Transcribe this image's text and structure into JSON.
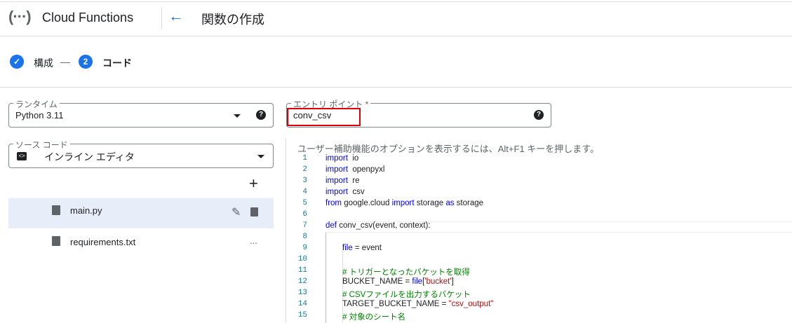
{
  "header": {
    "product": "Cloud Functions",
    "page_title": "関数の作成",
    "logo_icon": "cloud-functions-logo",
    "back_icon": "arrow-left-icon"
  },
  "stepper": {
    "steps": [
      {
        "label": "構成",
        "state": "done"
      },
      {
        "number": "2",
        "label": "コード",
        "state": "active"
      }
    ],
    "separator": "—"
  },
  "runtime": {
    "label": "ランタイム",
    "value": "Python 3.11",
    "help": "?"
  },
  "entry_point": {
    "label": "エントリ ポイント *",
    "value": "conv_csv",
    "help": "?",
    "highlight_color": "#e00000"
  },
  "source": {
    "label": "ソース コード",
    "value": "インライン エディタ"
  },
  "files": {
    "add": "+",
    "items": [
      {
        "name": "main.py",
        "selected": true
      },
      {
        "name": "requirements.txt",
        "selected": false,
        "more": "..."
      }
    ]
  },
  "editor": {
    "aria_hint": "ユーザー補助機能のオプションを表示するには、Alt+F1 キーを押します。",
    "lines": [
      {
        "n": "1",
        "tokens": [
          [
            "kw",
            "import"
          ],
          [
            "",
            "  io"
          ]
        ]
      },
      {
        "n": "2",
        "tokens": [
          [
            "kw",
            "import"
          ],
          [
            "",
            "  openpyxl"
          ]
        ]
      },
      {
        "n": "3",
        "tokens": [
          [
            "kw",
            "import"
          ],
          [
            "",
            "  re"
          ]
        ]
      },
      {
        "n": "4",
        "tokens": [
          [
            "kw",
            "import"
          ],
          [
            "",
            "  csv"
          ]
        ]
      },
      {
        "n": "5",
        "tokens": [
          [
            "kw",
            "from"
          ],
          [
            "",
            " google.cloud "
          ],
          [
            "kw",
            "import"
          ],
          [
            "",
            " storage "
          ],
          [
            "kw",
            "as"
          ],
          [
            "",
            " storage"
          ]
        ]
      },
      {
        "n": "6",
        "tokens": []
      },
      {
        "n": "7",
        "tokens": [
          [
            "kw",
            "def"
          ],
          [
            "",
            " conv_csv(event, context):"
          ]
        ]
      },
      {
        "n": "8",
        "tokens": []
      },
      {
        "n": "9",
        "indent": 2,
        "tokens": [
          [
            "kw",
            "file"
          ],
          [
            "",
            " = event"
          ]
        ]
      },
      {
        "n": "10",
        "tokens": []
      },
      {
        "n": "11",
        "indent": 2,
        "tokens": [
          [
            "cm",
            "# トリガーとなったバケットを取得"
          ]
        ]
      },
      {
        "n": "12",
        "indent": 2,
        "tokens": [
          [
            "",
            "BUCKET_NAME = "
          ],
          [
            "kw",
            "file"
          ],
          [
            "",
            "["
          ],
          [
            "str",
            "'bucket'"
          ],
          [
            "",
            "]"
          ]
        ]
      },
      {
        "n": "13",
        "indent": 2,
        "tokens": [
          [
            "cm",
            "# CSVファイルを出力するバケット"
          ]
        ]
      },
      {
        "n": "14",
        "indent": 2,
        "tokens": [
          [
            "",
            "TARGET_BUCKET_NAME = "
          ],
          [
            "str",
            "\"csv_output\""
          ]
        ]
      },
      {
        "n": "15",
        "indent": 2,
        "tokens": [
          [
            "cm",
            "# 対象のシート名"
          ]
        ]
      }
    ]
  }
}
